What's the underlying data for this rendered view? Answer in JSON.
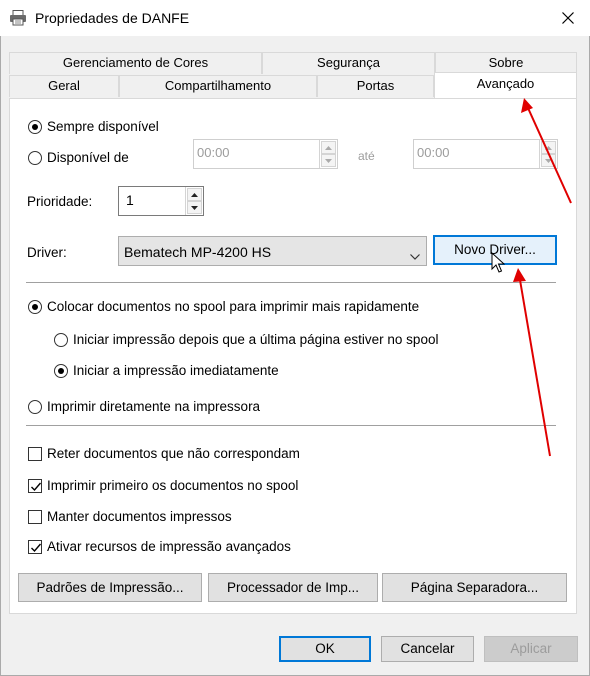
{
  "window": {
    "title": "Propriedades de DANFE"
  },
  "tabs": {
    "row1": [
      "Gerenciamento de Cores",
      "Segurança",
      "Sobre"
    ],
    "row2": [
      "Geral",
      "Compartilhamento",
      "Portas",
      "Avançado"
    ],
    "active": "Avançado"
  },
  "availability": {
    "always_label": "Sempre disponível",
    "from_label": "Disponível de",
    "from_time": "00:00",
    "to_label": "até",
    "to_time": "00:00",
    "selected": "always"
  },
  "priority": {
    "label": "Prioridade:",
    "value": "1"
  },
  "driver": {
    "label": "Driver:",
    "selected": "Bematech MP-4200 HS",
    "new_driver_button": "Novo Driver..."
  },
  "spool": {
    "spool_label": "Colocar documentos no spool para imprimir mais rapidamente",
    "start_after_last_page": "Iniciar impressão depois que a última página estiver no spool",
    "start_immediately": "Iniciar a impressão imediatamente",
    "print_direct": "Imprimir diretamente na impressora"
  },
  "options": [
    {
      "label": "Reter documentos que não correspondam",
      "checked": false
    },
    {
      "label": "Imprimir primeiro os documentos no spool",
      "checked": true
    },
    {
      "label": "Manter documentos impressos",
      "checked": false
    },
    {
      "label": "Ativar recursos de impressão avançados",
      "checked": true
    }
  ],
  "bottom_buttons": {
    "defaults": "Padrões de Impressão...",
    "processor": "Processador de Imp...",
    "separator_page": "Página Separadora..."
  },
  "dialog_buttons": {
    "ok": "OK",
    "cancel": "Cancelar",
    "apply": "Aplicar"
  },
  "colors": {
    "accent": "#0078d7",
    "annotation_arrow": "#e00000"
  }
}
